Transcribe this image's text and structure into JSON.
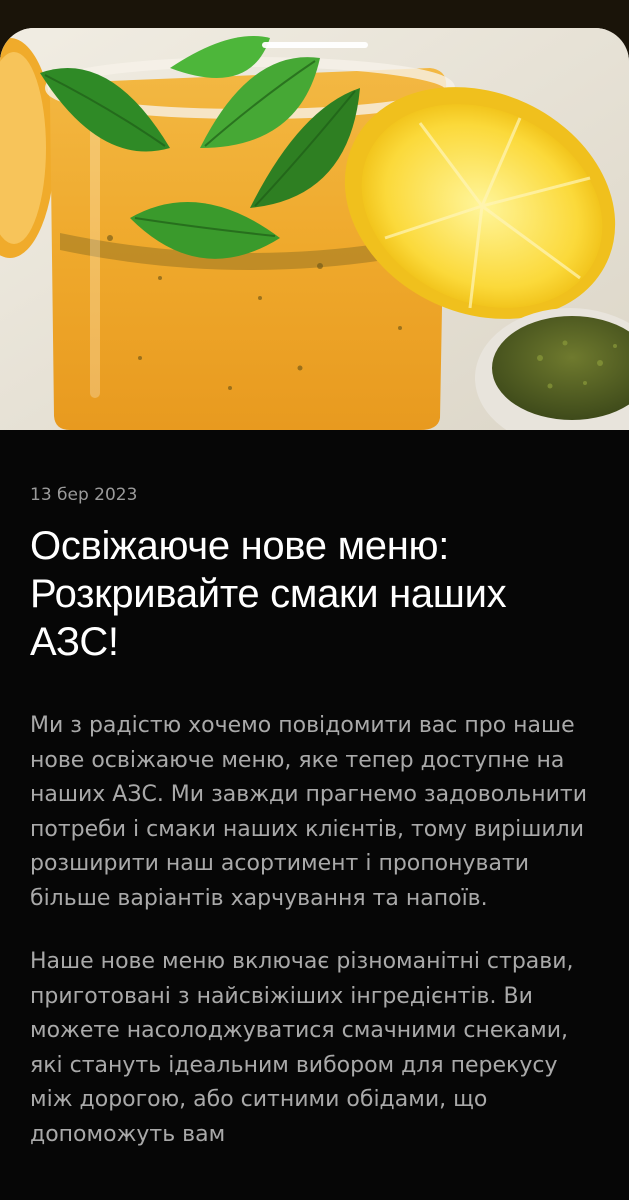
{
  "article": {
    "image_icon": "lemonade-photo",
    "date": "13 бер 2023",
    "title": "Освіжаюче нове меню: Розкривайте смаки наших АЗС!",
    "paragraphs": [
      "Ми з радістю хочемо повідомити вас про наше нове освіжаюче меню, яке тепер доступне на наших АЗС. Ми завжди прагнемо задовольнити потреби і смаки наших клієнтів, тому вирішили розширити наш асортимент і пропонувати більше варіантів харчування та напоїв.",
      "Наше нове меню включає різноманітні страви, приготовані з найсвіжіших інгредієнтів. Ви можете насолоджуватися смачними снеками, які стануть ідеальним вибором для перекусу між дорогою, або ситними обідами, що допоможуть вам"
    ]
  },
  "colors": {
    "background": "#060606",
    "title": "#ffffff",
    "body_text": "#a9a9a9",
    "date_text": "#9b9b9b"
  }
}
